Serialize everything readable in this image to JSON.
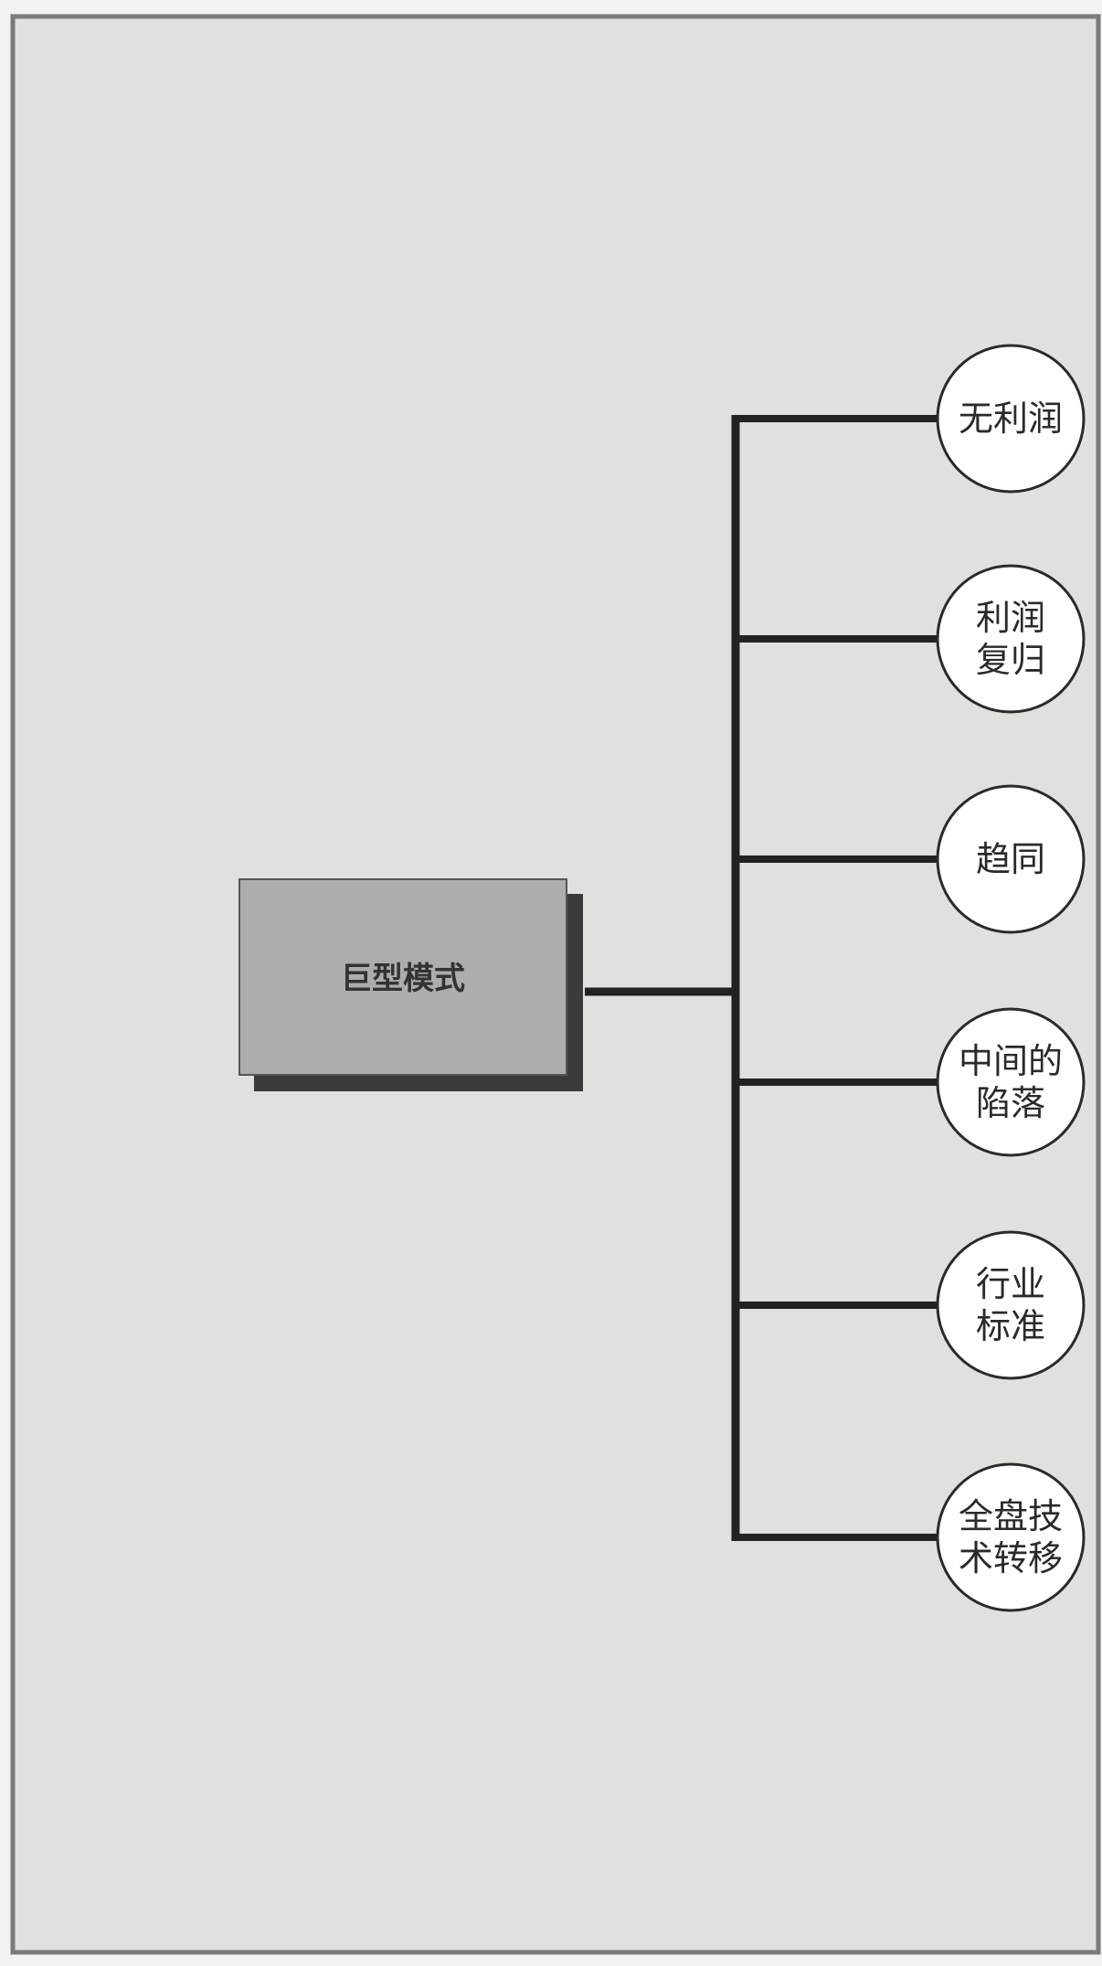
{
  "center": {
    "label": "巨型模式"
  },
  "branches": [
    {
      "lines": [
        "无利润"
      ]
    },
    {
      "lines": [
        "利润",
        "复归"
      ]
    },
    {
      "lines": [
        "趋同"
      ]
    },
    {
      "lines": [
        "中间的",
        "陷落"
      ]
    },
    {
      "lines": [
        "行业",
        "标准"
      ]
    },
    {
      "lines": [
        "全盘技",
        "术转移"
      ]
    }
  ],
  "colors": {
    "background": "#e0e0dc",
    "frame": "#7a7a7a",
    "box_fill": "#adadad",
    "box_shadow": "#3a3a3a",
    "line": "#222222",
    "circle_fill": "#ffffff",
    "circle_stroke": "#2a2a2a"
  }
}
